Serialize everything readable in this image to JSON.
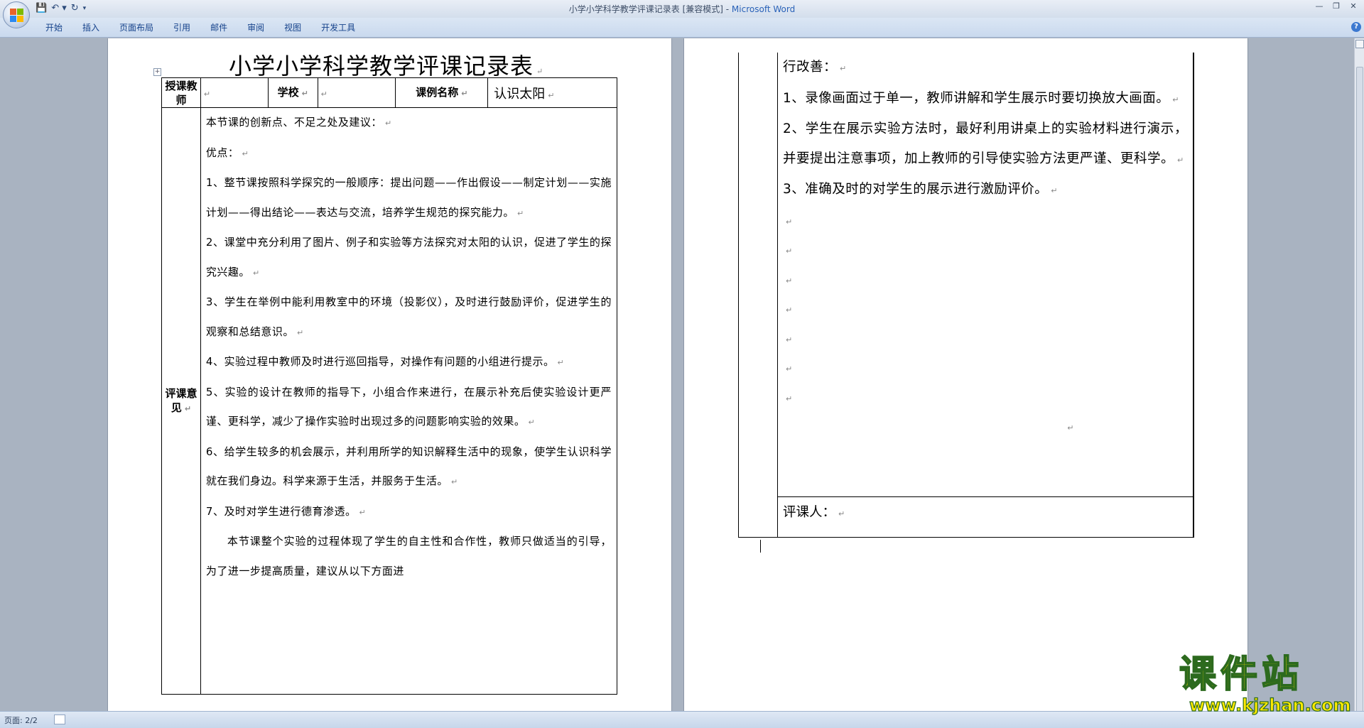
{
  "window": {
    "doc_name": "小学小学科学教学评课记录表 [兼容模式] - ",
    "app_name": "Microsoft Word"
  },
  "ribbon_tabs": [
    "开始",
    "插入",
    "页面布局",
    "引用",
    "邮件",
    "审阅",
    "视图",
    "开发工具"
  ],
  "document": {
    "title": "小学小学科学教学评课记录表",
    "header_row": {
      "teacher_label": "授课教师",
      "school_label": "学校",
      "lesson_label": "课例名称",
      "lesson_value": "认识太阳"
    },
    "review_label": "评课意见",
    "review_paras": [
      "本节课的创新点、不足之处及建议：",
      "优点：",
      "1、整节课按照科学探究的一般顺序：提出问题——作出假设——制定计划——实施计划——得出结论——表达与交流，培养学生规范的探究能力。",
      "2、课堂中充分利用了图片、例子和实验等方法探究对太阳的认识，促进了学生的探究兴趣。",
      "3、学生在举例中能利用教室中的环境（投影仪），及时进行鼓励评价，促进学生的观察和总结意识。",
      "4、实验过程中教师及时进行巡回指导，对操作有问题的小组进行提示。",
      "5、实验的设计在教师的指导下，小组合作来进行，在展示补充后使实验设计更严谨、更科学，减少了操作实验时出现过多的问题影响实验的效果。",
      "6、给学生较多的机会展示，并利用所学的知识解释生活中的现象，使学生认识科学就在我们身边。科学来源于生活，并服务于生活。",
      "7、及时对学生进行德育渗透。",
      "本节课整个实验的过程体现了学生的自主性和合作性，教师只做适当的引导，为了进一步提高质量，建议从以下方面进"
    ],
    "page2_paras": [
      "行改善：",
      "1、录像画面过于单一，教师讲解和学生展示时要切换放大画面。",
      "2、学生在展示实验方法时，最好利用讲桌上的实验材料进行演示，并要提出注意事项，加上教师的引导使实验方法更严谨、更科学。",
      "3、准确及时的对学生的展示进行激励评价。"
    ],
    "reviewer_label": "评课人："
  },
  "status": {
    "page": "页面: 2/2"
  },
  "watermark": {
    "text": "课件站",
    "url": "www.kjzhan.com"
  }
}
